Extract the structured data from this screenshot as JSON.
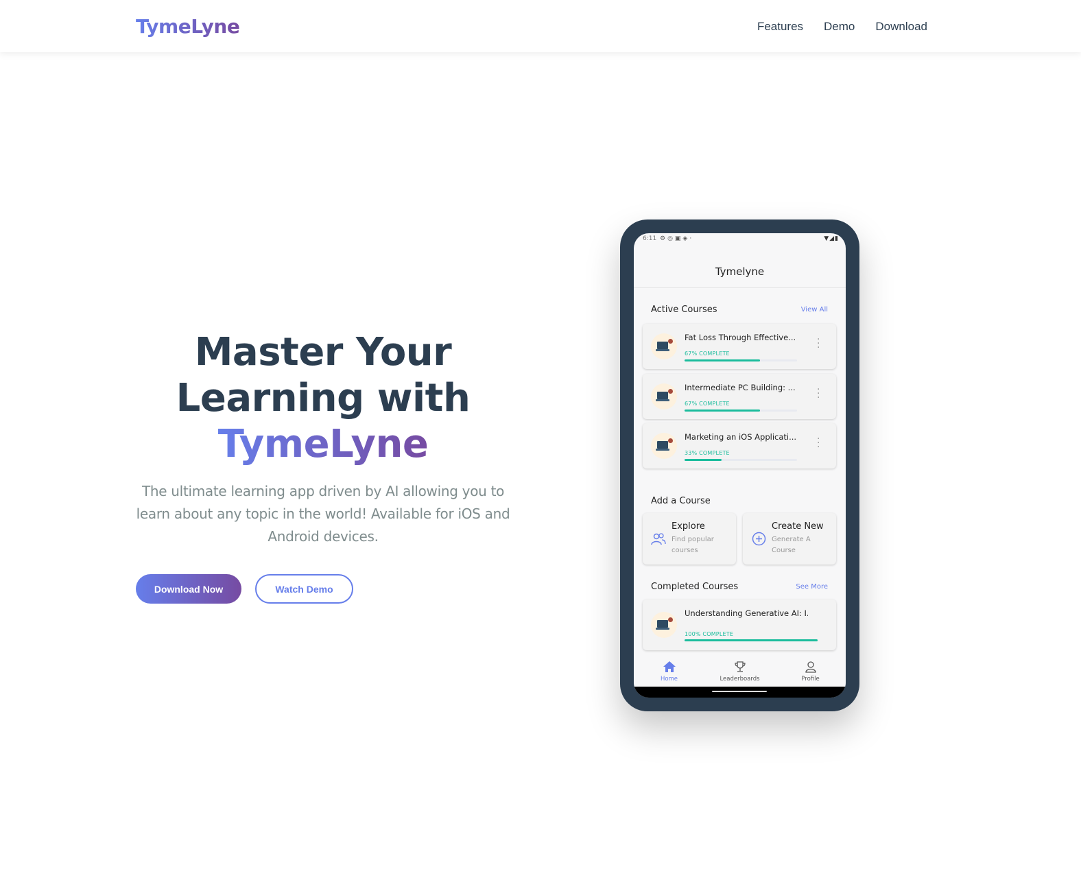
{
  "nav": {
    "logo": "TymeLyne",
    "links": [
      "Features",
      "Demo",
      "Download"
    ]
  },
  "hero": {
    "title_line1": "Master Your",
    "title_line2": "Learning with",
    "title_highlight": "TymeLyne",
    "subtitle": "The ultimate learning app driven by AI allowing you to learn about any topic in the world! Available for iOS and Android devices.",
    "primary_button": "Download Now",
    "secondary_button": "Watch Demo"
  },
  "colors": {
    "accent_start": "#667eea",
    "accent_end": "#764ba2",
    "heading": "#2c3e50",
    "muted": "#7f8c8d",
    "progress": "#1abc9c"
  },
  "phone": {
    "status_time": "6:11",
    "app_title": "Tymelyne",
    "active_title": "Active Courses",
    "active_link": "View All",
    "active_courses": [
      {
        "name": "Fat Loss Through Effective...",
        "progress_label": "67% COMPLETE",
        "progress": 0.67
      },
      {
        "name": "Intermediate PC Building: ...",
        "progress_label": "67% COMPLETE",
        "progress": 0.67
      },
      {
        "name": "Marketing an iOS Applicati...",
        "progress_label": "33% COMPLETE",
        "progress": 0.33
      }
    ],
    "add_title": "Add a Course",
    "explore_title": "Explore",
    "explore_desc": "Find popular courses",
    "create_title": "Create New",
    "create_desc": "Generate A Course",
    "completed_title": "Completed Courses",
    "completed_link": "See More",
    "completed_courses": [
      {
        "name": "Understanding Generative AI: I...",
        "progress_label": "100% COMPLETE",
        "progress": 1.0
      }
    ],
    "tabs": [
      {
        "label": "Home",
        "icon": "home-icon",
        "active": true
      },
      {
        "label": "Leaderboards",
        "icon": "trophy-icon",
        "active": false
      },
      {
        "label": "Profile",
        "icon": "user-icon",
        "active": false
      }
    ]
  }
}
